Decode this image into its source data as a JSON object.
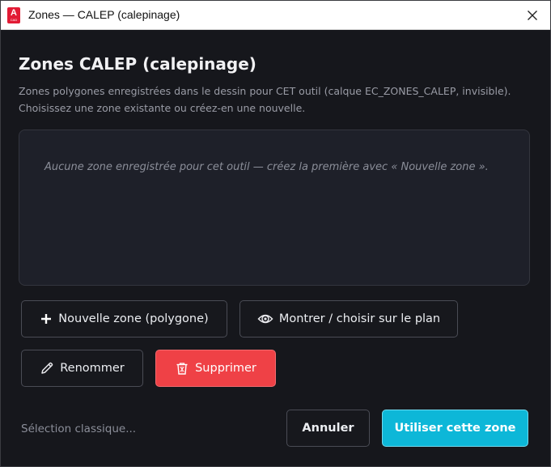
{
  "window": {
    "title": "Zones — CALEP (calepinage)",
    "app_icon_letter": "A",
    "app_icon_sub": "CAD"
  },
  "dialog": {
    "heading": "Zones CALEP (calepinage)",
    "description_line1": "Zones polygones enregistrées dans le dessin pour CET outil (calque EC_ZONES_CALEP, invisible).",
    "description_line2": "Choisissez une zone existante ou créez-en une nouvelle.",
    "empty_message": "Aucune zone enregistrée pour cet outil — créez la première avec « Nouvelle zone »."
  },
  "actions": {
    "new_zone": "Nouvelle zone (polygone)",
    "show_on_plan": "Montrer / choisir sur le plan",
    "rename": "Renommer",
    "delete": "Supprimer"
  },
  "footer": {
    "classic_selection": "Sélection classique...",
    "cancel": "Annuler",
    "use_zone": "Utiliser cette zone"
  },
  "colors": {
    "background": "#16171c",
    "list_background": "#1e2029",
    "danger": "#ef4146",
    "primary": "#0db7d8",
    "app_icon": "#e21b35"
  },
  "icons": {
    "new_zone": "plus-icon",
    "show_on_plan": "target-eye-icon",
    "rename": "pencil-icon",
    "delete": "trash-icon",
    "close": "close-icon"
  }
}
